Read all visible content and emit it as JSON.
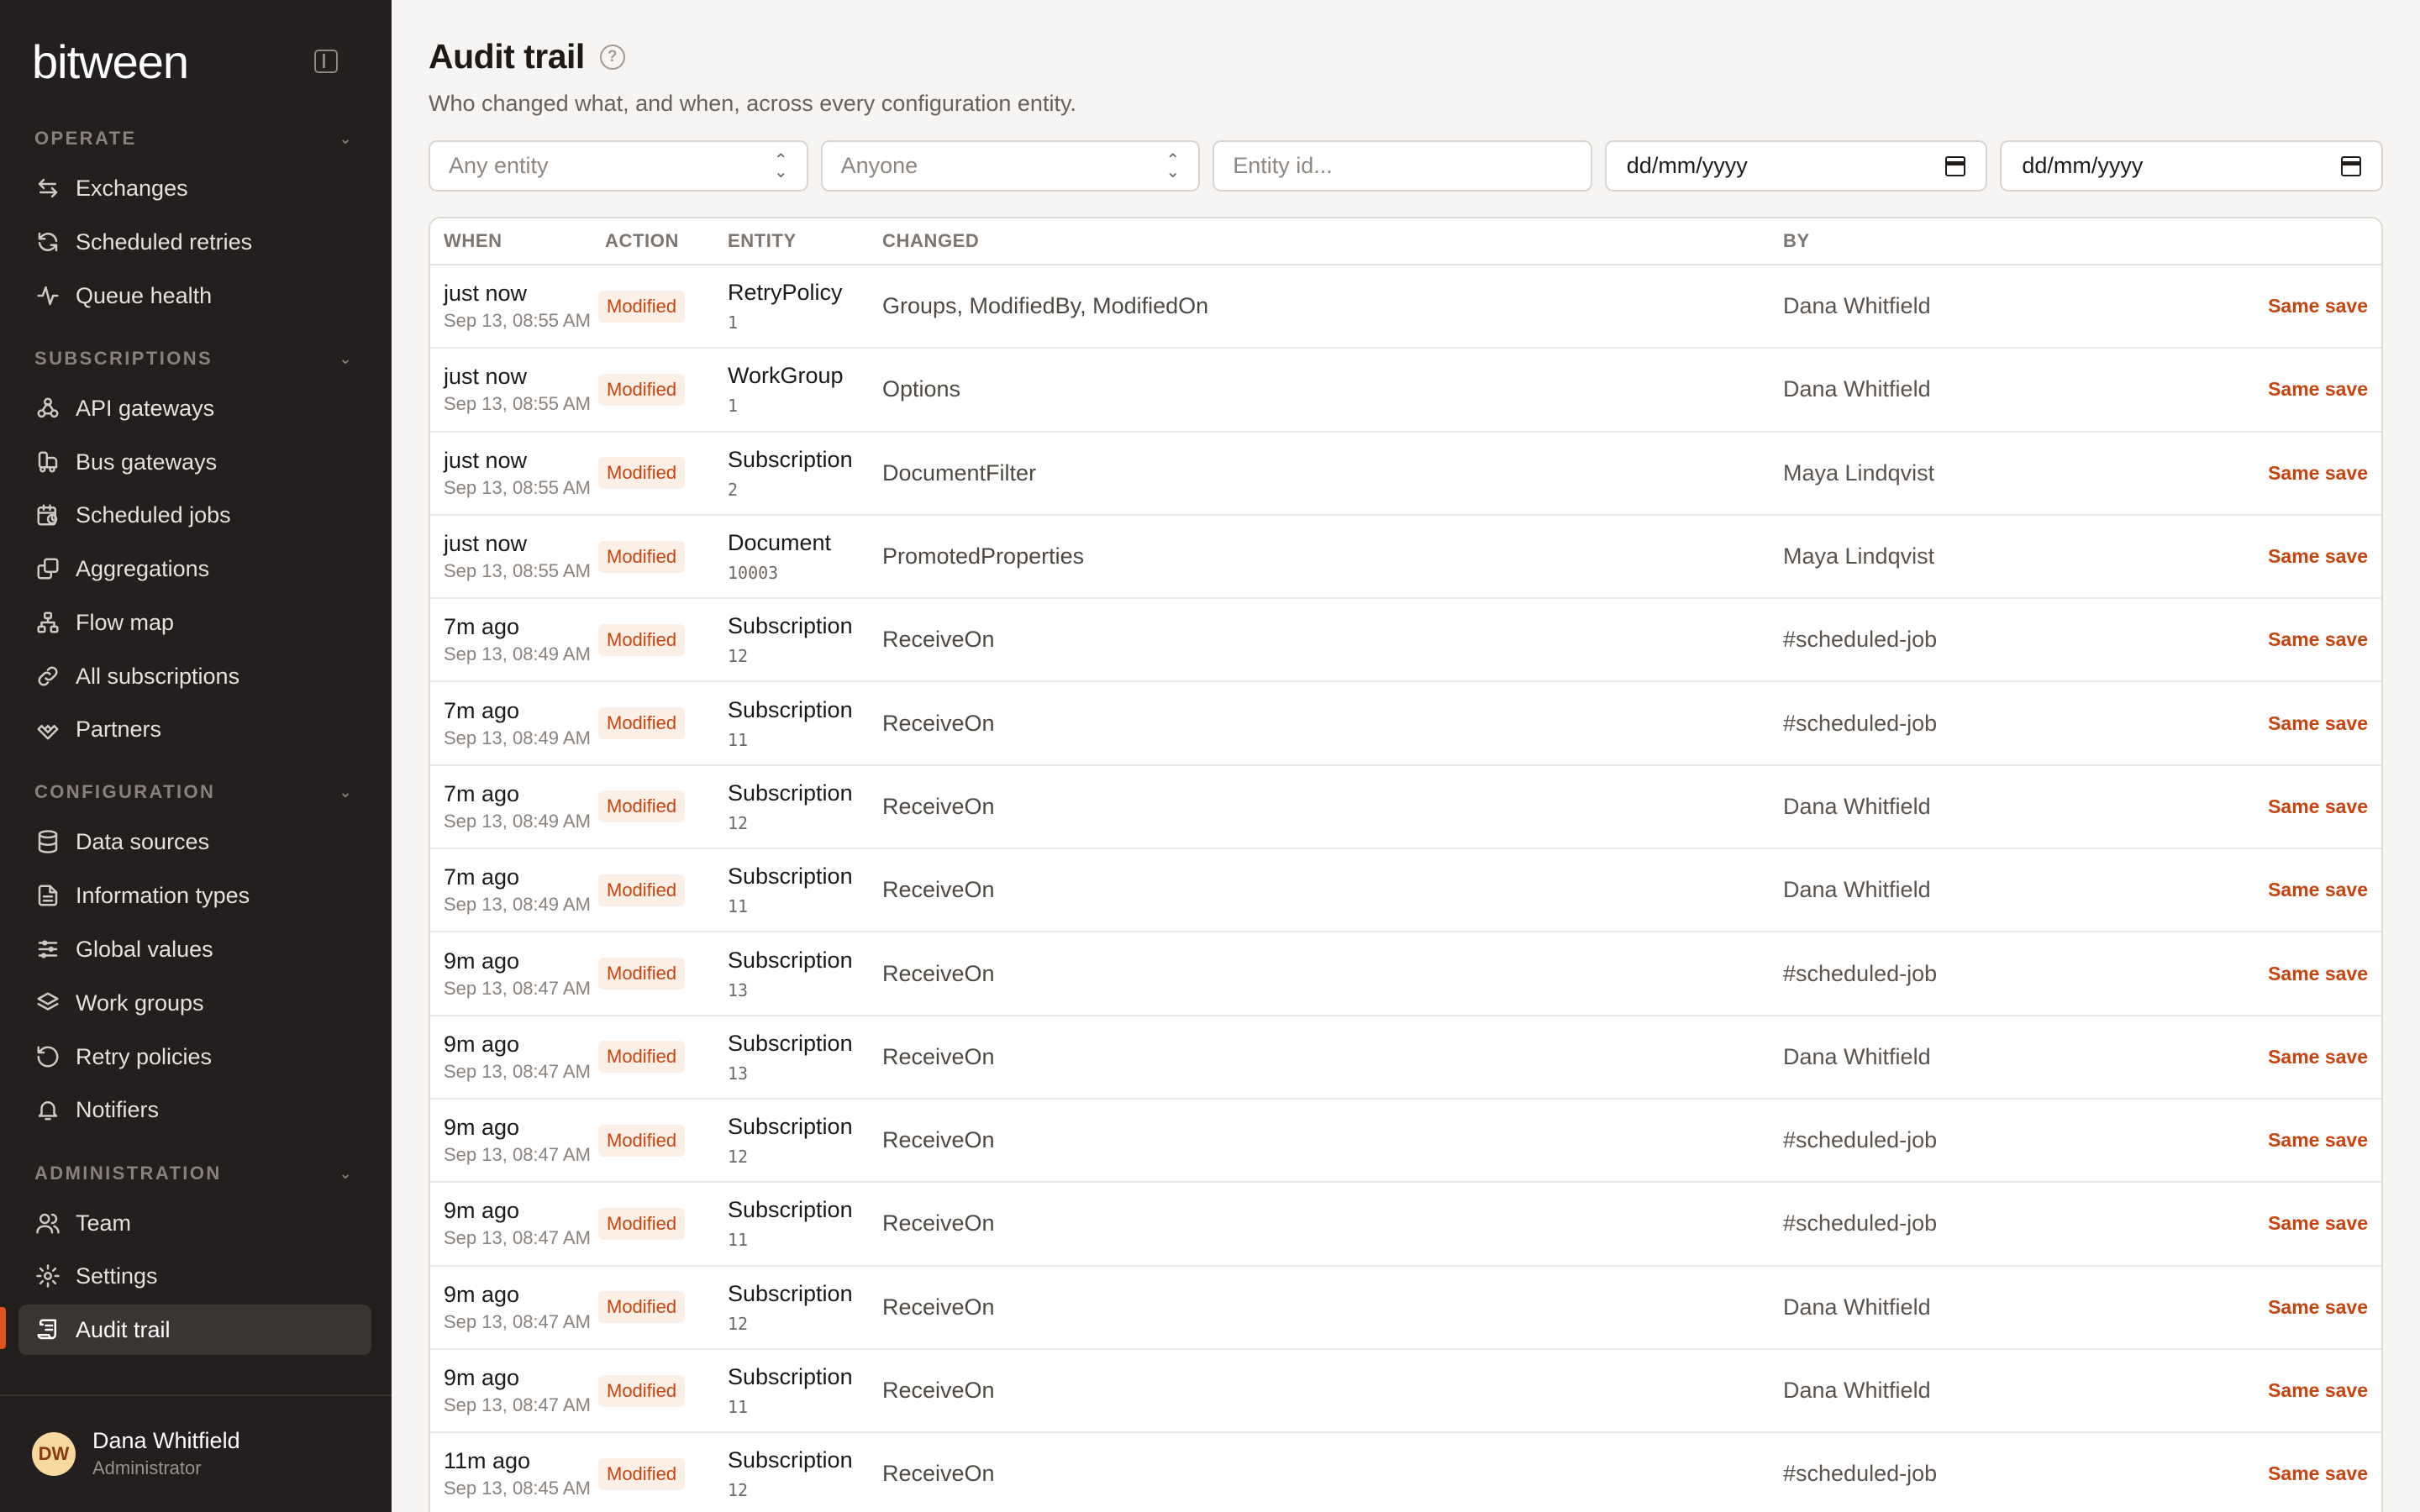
{
  "app": {
    "logo": "bitween"
  },
  "sidebar": {
    "sections": [
      {
        "title": "OPERATE",
        "items": [
          {
            "label": "Exchanges",
            "icon": "arrows-left-right-icon"
          },
          {
            "label": "Scheduled retries",
            "icon": "refresh-icon"
          },
          {
            "label": "Queue health",
            "icon": "pulse-icon"
          }
        ]
      },
      {
        "title": "SUBSCRIPTIONS",
        "items": [
          {
            "label": "API gateways",
            "icon": "webhook-icon"
          },
          {
            "label": "Bus gateways",
            "icon": "bus-icon"
          },
          {
            "label": "Scheduled jobs",
            "icon": "calendar-clock-icon"
          },
          {
            "label": "Aggregations",
            "icon": "layers-copy-icon"
          },
          {
            "label": "Flow map",
            "icon": "network-icon"
          },
          {
            "label": "All subscriptions",
            "icon": "link-icon"
          },
          {
            "label": "Partners",
            "icon": "handshake-icon"
          }
        ]
      },
      {
        "title": "CONFIGURATION",
        "items": [
          {
            "label": "Data sources",
            "icon": "database-icon"
          },
          {
            "label": "Information types",
            "icon": "file-text-icon"
          },
          {
            "label": "Global values",
            "icon": "sliders-icon"
          },
          {
            "label": "Work groups",
            "icon": "layers-icon"
          },
          {
            "label": "Retry policies",
            "icon": "rotate-ccw-icon"
          },
          {
            "label": "Notifiers",
            "icon": "bell-icon"
          }
        ]
      },
      {
        "title": "ADMINISTRATION",
        "items": [
          {
            "label": "Team",
            "icon": "users-icon"
          },
          {
            "label": "Settings",
            "icon": "gear-icon"
          },
          {
            "label": "Audit trail",
            "icon": "scroll-icon"
          }
        ]
      }
    ],
    "active_item": "Audit trail",
    "user": {
      "initials": "DW",
      "name": "Dana Whitfield",
      "role": "Administrator"
    }
  },
  "page": {
    "title": "Audit trail",
    "subtitle": "Who changed what, and when, across every configuration entity."
  },
  "filters": {
    "entity": "Any entity",
    "user": "Anyone",
    "entity_id_placeholder": "Entity id...",
    "date_from": "dd/mm/yyyy",
    "date_to": "dd/mm/yyyy"
  },
  "table": {
    "headers": {
      "when": "WHEN",
      "action": "ACTION",
      "entity": "ENTITY",
      "changed": "CHANGED",
      "by": "BY"
    },
    "rows": [
      {
        "when": "just now",
        "ts": "Sep 13, 08:55 AM",
        "action": "Modified",
        "entity": "RetryPolicy",
        "id": "1",
        "changed": "Groups, ModifiedBy, ModifiedOn",
        "by": "Dana Whitfield",
        "link": "Same save"
      },
      {
        "when": "just now",
        "ts": "Sep 13, 08:55 AM",
        "action": "Modified",
        "entity": "WorkGroup",
        "id": "1",
        "changed": "Options",
        "by": "Dana Whitfield",
        "link": "Same save"
      },
      {
        "when": "just now",
        "ts": "Sep 13, 08:55 AM",
        "action": "Modified",
        "entity": "Subscription",
        "id": "2",
        "changed": "DocumentFilter",
        "by": "Maya Lindqvist",
        "link": "Same save"
      },
      {
        "when": "just now",
        "ts": "Sep 13, 08:55 AM",
        "action": "Modified",
        "entity": "Document",
        "id": "10003",
        "changed": "PromotedProperties",
        "by": "Maya Lindqvist",
        "link": "Same save"
      },
      {
        "when": "7m ago",
        "ts": "Sep 13, 08:49 AM",
        "action": "Modified",
        "entity": "Subscription",
        "id": "12",
        "changed": "ReceiveOn",
        "by": "#scheduled-job",
        "link": "Same save"
      },
      {
        "when": "7m ago",
        "ts": "Sep 13, 08:49 AM",
        "action": "Modified",
        "entity": "Subscription",
        "id": "11",
        "changed": "ReceiveOn",
        "by": "#scheduled-job",
        "link": "Same save"
      },
      {
        "when": "7m ago",
        "ts": "Sep 13, 08:49 AM",
        "action": "Modified",
        "entity": "Subscription",
        "id": "12",
        "changed": "ReceiveOn",
        "by": "Dana Whitfield",
        "link": "Same save"
      },
      {
        "when": "7m ago",
        "ts": "Sep 13, 08:49 AM",
        "action": "Modified",
        "entity": "Subscription",
        "id": "11",
        "changed": "ReceiveOn",
        "by": "Dana Whitfield",
        "link": "Same save"
      },
      {
        "when": "9m ago",
        "ts": "Sep 13, 08:47 AM",
        "action": "Modified",
        "entity": "Subscription",
        "id": "13",
        "changed": "ReceiveOn",
        "by": "#scheduled-job",
        "link": "Same save"
      },
      {
        "when": "9m ago",
        "ts": "Sep 13, 08:47 AM",
        "action": "Modified",
        "entity": "Subscription",
        "id": "13",
        "changed": "ReceiveOn",
        "by": "Dana Whitfield",
        "link": "Same save"
      },
      {
        "when": "9m ago",
        "ts": "Sep 13, 08:47 AM",
        "action": "Modified",
        "entity": "Subscription",
        "id": "12",
        "changed": "ReceiveOn",
        "by": "#scheduled-job",
        "link": "Same save"
      },
      {
        "when": "9m ago",
        "ts": "Sep 13, 08:47 AM",
        "action": "Modified",
        "entity": "Subscription",
        "id": "11",
        "changed": "ReceiveOn",
        "by": "#scheduled-job",
        "link": "Same save"
      },
      {
        "when": "9m ago",
        "ts": "Sep 13, 08:47 AM",
        "action": "Modified",
        "entity": "Subscription",
        "id": "12",
        "changed": "ReceiveOn",
        "by": "Dana Whitfield",
        "link": "Same save"
      },
      {
        "when": "9m ago",
        "ts": "Sep 13, 08:47 AM",
        "action": "Modified",
        "entity": "Subscription",
        "id": "11",
        "changed": "ReceiveOn",
        "by": "Dana Whitfield",
        "link": "Same save"
      },
      {
        "when": "11m ago",
        "ts": "Sep 13, 08:45 AM",
        "action": "Modified",
        "entity": "Subscription",
        "id": "12",
        "changed": "ReceiveOn",
        "by": "#scheduled-job",
        "link": "Same save"
      }
    ]
  },
  "colors": {
    "accent": "#c8430e",
    "sidebar_bg": "#231f1e",
    "badge_bg": "#fcefe6"
  }
}
